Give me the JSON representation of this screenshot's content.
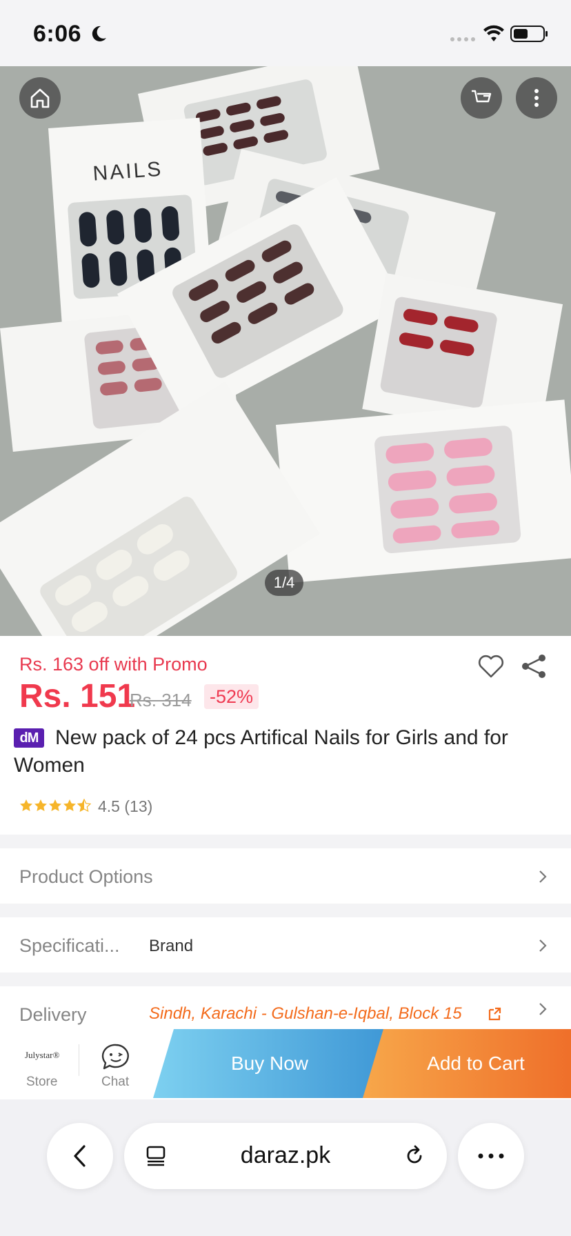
{
  "status_bar": {
    "time": "6:06"
  },
  "hero": {
    "page_indicator": "1/4",
    "box_brand_text": "NAILS"
  },
  "product": {
    "promo_text": "Rs. 163 off with Promo",
    "price": "Rs. 151",
    "original_price": "Rs. 314",
    "discount": "-52%",
    "badge": "dM",
    "title": "New pack of 24 pcs Artifical Nails for Girls and for Women",
    "rating_value": "4.5",
    "rating_count": "(13)",
    "stars_filled": 4.5
  },
  "rows": {
    "options_label": "Product Options",
    "spec_label": "Specificati...",
    "spec_value": "Brand",
    "delivery_label": "Delivery",
    "delivery_value": "Sindh, Karachi - Gulshan-e-Iqbal, Block 15"
  },
  "action_bar": {
    "store_logo": "Julystar®",
    "store_label": "Store",
    "chat_label": "Chat",
    "buy_now": "Buy Now",
    "add_to_cart": "Add to Cart"
  },
  "browser": {
    "url": "daraz.pk"
  },
  "colors": {
    "price_red": "#f0394d",
    "delivery_orange": "#f36b1c",
    "buy_now_blue": "#3f98d6",
    "add_cart_orange": "#ef6f2a",
    "badge_purple": "#5a1fb0"
  }
}
